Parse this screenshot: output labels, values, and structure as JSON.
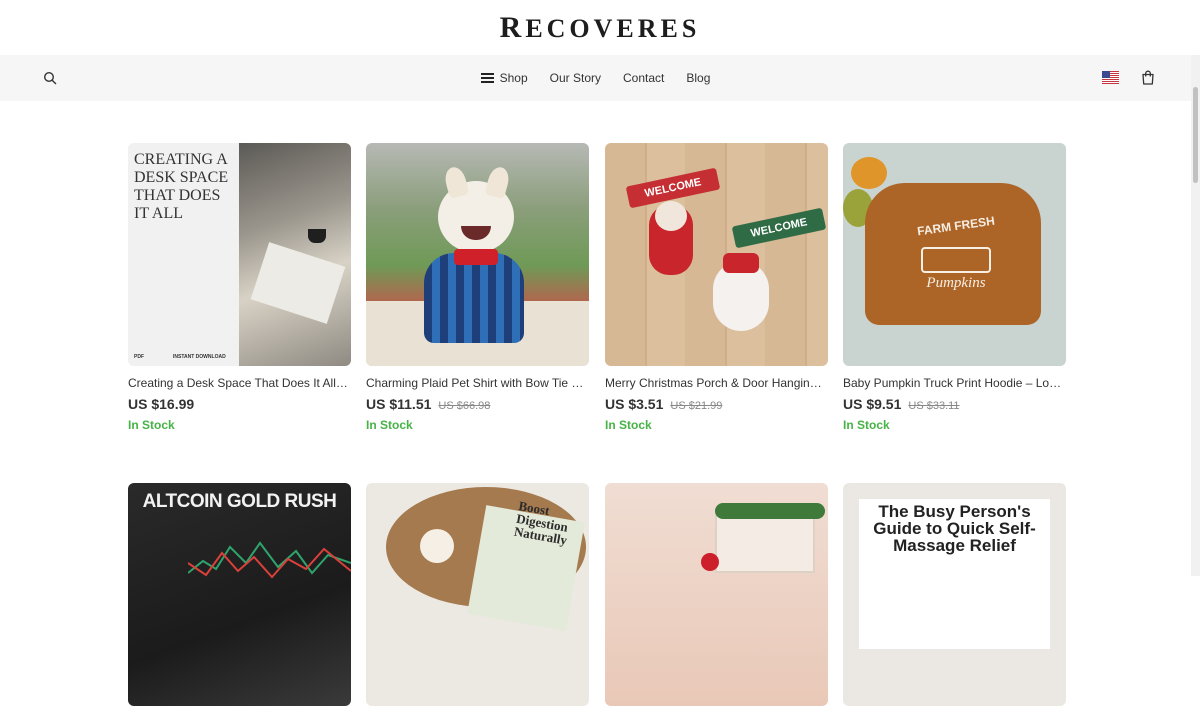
{
  "header": {
    "logo_first": "R",
    "logo_rest": "ECOVERES"
  },
  "nav": {
    "items": [
      {
        "label": "Shop"
      },
      {
        "label": "Our Story"
      },
      {
        "label": "Contact"
      },
      {
        "label": "Blog"
      }
    ],
    "search_icon": "search-icon",
    "flag_icon": "us-flag-icon",
    "cart_icon": "shopping-bag-icon"
  },
  "products": [
    {
      "title": "Creating a Desk Space That Does It All –…",
      "price": "US $16.99",
      "old_price": "",
      "stock": "In Stock",
      "image": {
        "headline": "CREATING A DESK SPACE THAT DOES IT ALL",
        "tag_left": "PDF",
        "tag_right": "INSTANT DOWNLOAD"
      }
    },
    {
      "title": "Charming Plaid Pet Shirt with Bow Tie –…",
      "price": "US $11.51",
      "old_price": "US $66.98",
      "stock": "In Stock",
      "image": {}
    },
    {
      "title": "Merry Christmas Porch & Door Hanging…",
      "price": "US $3.51",
      "old_price": "US $21.99",
      "stock": "In Stock",
      "image": {
        "sign1": "WELCOME",
        "sign2": "WELCOME"
      }
    },
    {
      "title": "Baby Pumpkin Truck Print Hoodie – Long…",
      "price": "US $9.51",
      "old_price": "US $33.11",
      "stock": "In Stock",
      "image": {
        "line1": "FARM FRESH",
        "line2": "Pumpkins"
      }
    }
  ],
  "row2": [
    {
      "headline": "ALTCOIN GOLD RUSH"
    },
    {
      "headline": "Boost Digestion Naturally"
    },
    {
      "headline": ""
    },
    {
      "headline": "The Busy Person's Guide to Quick Self-Massage Relief"
    }
  ],
  "colors": {
    "in_stock": "#47b347",
    "nav_bg": "#f6f6f6"
  }
}
